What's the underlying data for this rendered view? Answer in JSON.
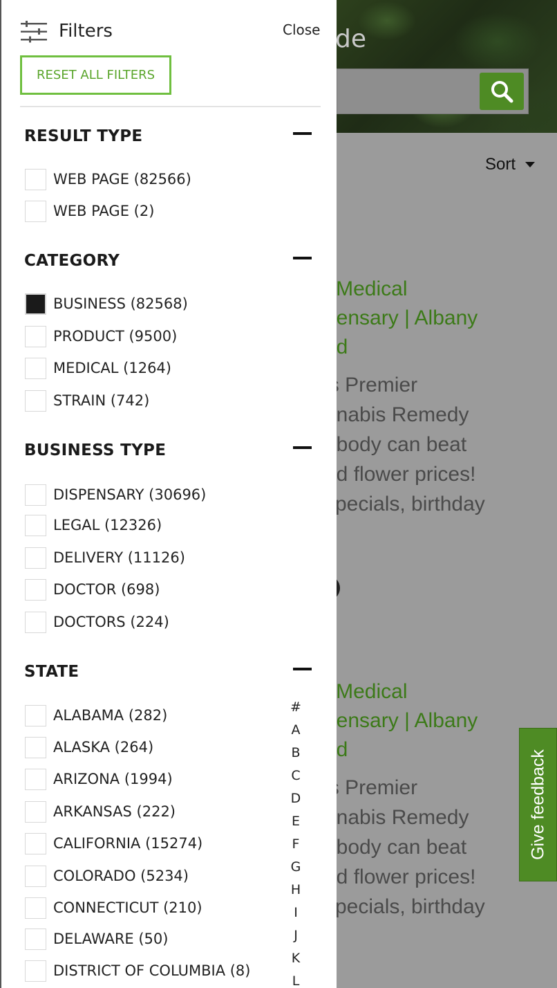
{
  "background": {
    "hero_title": "de",
    "sort_label": "Sort",
    "results": [
      {
        "title_lines": [
          "| Medical",
          "pensary | Albany",
          "ud"
        ],
        "desc_lines": [
          "'s Premier",
          "nnabis Remedy",
          "obody can beat",
          "nd flower prices!",
          "specials, birthday"
        ]
      },
      {
        "title_lines": [
          "| Medical",
          "pensary | Albany",
          "ud"
        ],
        "desc_lines": [
          "'s Premier",
          "nnabis Remedy",
          "obody can beat",
          "nd flower prices!",
          "specials, birthday"
        ]
      }
    ],
    "feedback_label": "Give feedback"
  },
  "drawer": {
    "title": "Filters",
    "close_label": "Close",
    "reset_label": "RESET ALL FILTERS",
    "sections": {
      "result_type": {
        "heading": "RESULT TYPE",
        "options": [
          {
            "label": "WEB PAGE (82566)",
            "checked": false
          },
          {
            "label": "WEB PAGE (2)",
            "checked": false
          }
        ]
      },
      "category": {
        "heading": "CATEGORY",
        "options": [
          {
            "label": "BUSINESS (82568)",
            "checked": true
          },
          {
            "label": "PRODUCT (9500)",
            "checked": false
          },
          {
            "label": "MEDICAL (1264)",
            "checked": false
          },
          {
            "label": "STRAIN (742)",
            "checked": false
          }
        ]
      },
      "business_type": {
        "heading": "BUSINESS TYPE",
        "options": [
          {
            "label": "DISPENSARY (30696)",
            "checked": false
          },
          {
            "label": "LEGAL (12326)",
            "checked": false
          },
          {
            "label": "DELIVERY (11126)",
            "checked": false
          },
          {
            "label": "DOCTOR (698)",
            "checked": false
          },
          {
            "label": "DOCTORS (224)",
            "checked": false
          }
        ]
      },
      "state": {
        "heading": "STATE",
        "options": [
          {
            "label": "ALABAMA (282)",
            "checked": false
          },
          {
            "label": "ALASKA (264)",
            "checked": false
          },
          {
            "label": "ARIZONA (1994)",
            "checked": false
          },
          {
            "label": "ARKANSAS (222)",
            "checked": false
          },
          {
            "label": "CALIFORNIA (15274)",
            "checked": false
          },
          {
            "label": "COLORADO (5234)",
            "checked": false
          },
          {
            "label": "CONNECTICUT (210)",
            "checked": false
          },
          {
            "label": "DELAWARE (50)",
            "checked": false
          },
          {
            "label": "DISTRICT OF COLUMBIA (8)",
            "checked": false
          }
        ],
        "alpha_index": [
          "#",
          "A",
          "B",
          "C",
          "D",
          "E",
          "F",
          "G",
          "H",
          "I",
          "J",
          "K",
          "L"
        ]
      }
    }
  },
  "colors": {
    "accent_green": "#4e8b24",
    "reset_border": "#6fbf3f",
    "link_green": "#3c7a18"
  }
}
